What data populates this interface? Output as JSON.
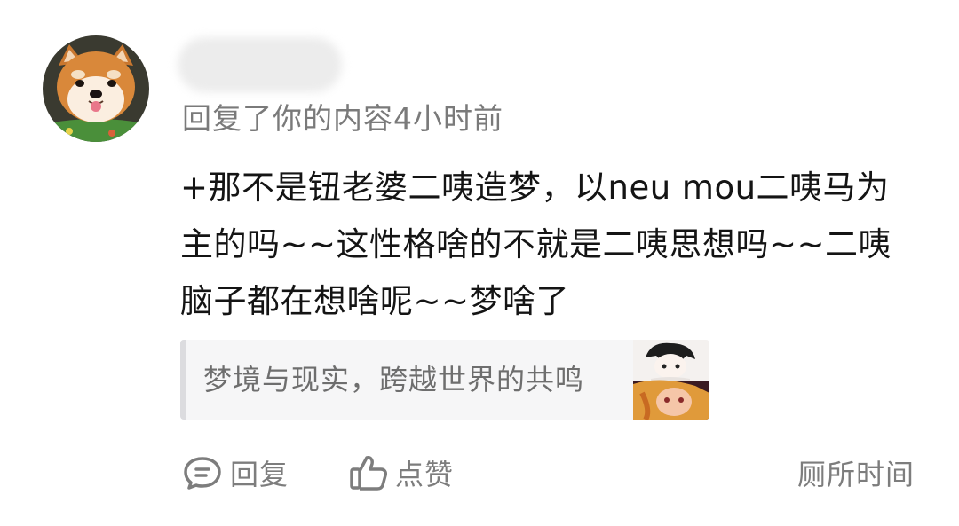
{
  "comment": {
    "meta_text": "回复了你的内容4小时前",
    "body_lines": [
      "+那不是钮老婆二咦造梦，以neu mou二咦马为",
      "主的吗~~这性格啥的不就是二咦思想吗~~二咦",
      "脑子都在想啥呢~~梦啥了"
    ]
  },
  "quote": {
    "text": "梦境与现实，跨越世界的共鸣"
  },
  "actions": {
    "reply_label": "回复",
    "like_label": "点赞",
    "time_label": "厕所时间"
  },
  "icons": {
    "reply": "chat-bubble-icon",
    "like": "thumbs-up-icon"
  },
  "colors": {
    "text_primary": "#141414",
    "text_secondary": "#7a7a7a",
    "quote_bg": "#f6f6f7",
    "quote_bar": "#dcdcdf"
  }
}
